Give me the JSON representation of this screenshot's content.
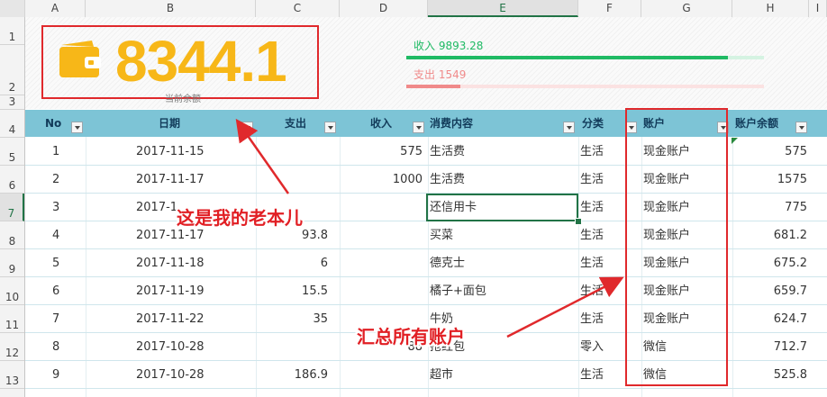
{
  "sheet": {
    "column_headers": [
      "A",
      "B",
      "C",
      "D",
      "E",
      "F",
      "G",
      "H",
      "I"
    ],
    "row_headers": [
      "1",
      "2",
      "3",
      "4",
      "5",
      "6",
      "7",
      "8",
      "9",
      "10",
      "11",
      "12",
      "13"
    ],
    "active_column": "E",
    "active_row": "7"
  },
  "dashboard": {
    "balance_value": "8344.1",
    "balance_label": "当前余额",
    "income_label": "收入 9893.28",
    "expense_label": "支出 1549",
    "income_fraction": 0.9,
    "expense_fraction": 0.15,
    "colors": {
      "balance": "#f7b718",
      "income": "#1fba64",
      "expense": "#f08a8a",
      "annotation": "#e0292c"
    }
  },
  "table": {
    "headers": [
      "No",
      "日期",
      "支出",
      "收入",
      "消费内容",
      "分类",
      "账户",
      "账户余额"
    ],
    "rows": [
      {
        "no": "1",
        "date": "2017-11-15",
        "expense": "",
        "income": "575",
        "item": "生活费",
        "category": "生活",
        "account": "现金账户",
        "balance": "575"
      },
      {
        "no": "2",
        "date": "2017-11-17",
        "expense": "",
        "income": "1000",
        "item": "生活费",
        "category": "生活",
        "account": "现金账户",
        "balance": "1575"
      },
      {
        "no": "3",
        "date": "2017-1",
        "expense": "",
        "income": "",
        "item": "还信用卡",
        "category": "生活",
        "account": "现金账户",
        "balance": "775"
      },
      {
        "no": "4",
        "date": "2017-11-17",
        "expense": "93.8",
        "income": "",
        "item": "买菜",
        "category": "生活",
        "account": "现金账户",
        "balance": "681.2"
      },
      {
        "no": "5",
        "date": "2017-11-18",
        "expense": "6",
        "income": "",
        "item": "德克士",
        "category": "生活",
        "account": "现金账户",
        "balance": "675.2"
      },
      {
        "no": "6",
        "date": "2017-11-19",
        "expense": "15.5",
        "income": "",
        "item": "橘子+面包",
        "category": "生活",
        "account": "现金账户",
        "balance": "659.7"
      },
      {
        "no": "7",
        "date": "2017-11-22",
        "expense": "35",
        "income": "",
        "item": "牛奶",
        "category": "生活",
        "account": "现金账户",
        "balance": "624.7"
      },
      {
        "no": "8",
        "date": "2017-10-28",
        "expense": "",
        "income": "88",
        "item": "抢红包",
        "category": "零入",
        "account": "微信",
        "balance": "712.7"
      },
      {
        "no": "9",
        "date": "2017-10-28",
        "expense": "186.9",
        "income": "",
        "item": "超市",
        "category": "生活",
        "account": "微信",
        "balance": "525.8"
      }
    ]
  },
  "annotations": {
    "callout_1": "这是我的老本儿",
    "callout_2": "汇总所有账户"
  }
}
